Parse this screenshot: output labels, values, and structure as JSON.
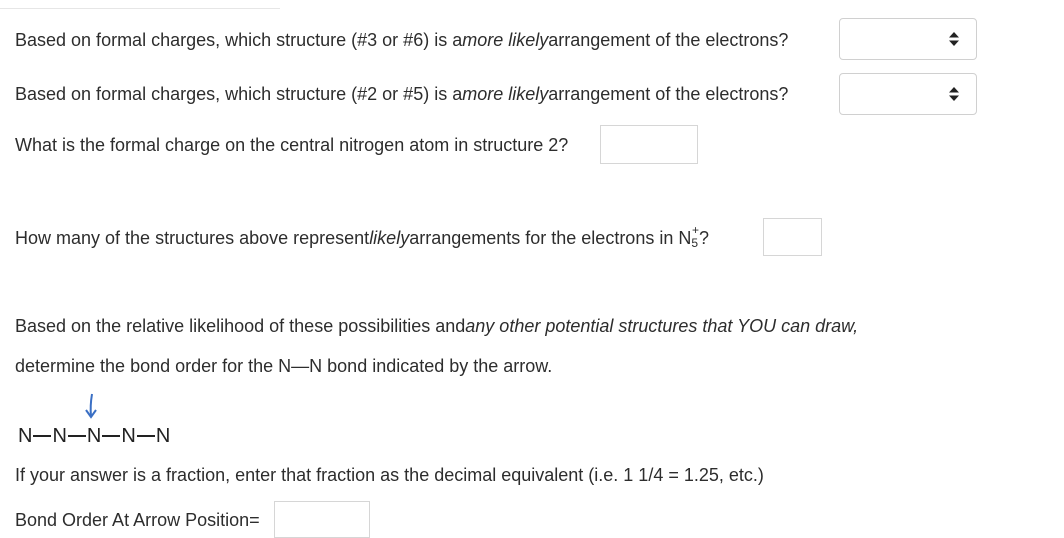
{
  "q1": {
    "pre": "Based on formal charges, which structure (#3 or #6) is a ",
    "em": "more likely",
    "post": " arrangement of the electrons?"
  },
  "q2": {
    "pre": "Based on formal charges, which structure (#2 or #5) is a ",
    "em": "more likely",
    "post": " arrangement of the electrons?"
  },
  "q3": {
    "text": "What is the formal charge on the central nitrogen atom in structure 2?"
  },
  "q4": {
    "pre": "How many of the structures above represent ",
    "em": "likely",
    "post": " arrangements for the electrons in N",
    "sub": "5",
    "sup": "+",
    "end": "?"
  },
  "q5": {
    "pre": "Based on the relative likelihood of these possibilities and ",
    "em": "any other potential structures that YOU can draw,",
    "line2": "determine the bond order for the N—N bond indicated by the arrow."
  },
  "chain": {
    "atoms": [
      "N",
      "N",
      "N",
      "N",
      "N"
    ]
  },
  "hint": "If your answer is a fraction, enter that fraction as the decimal equivalent (i.e. 1 1/4 = 1.25, etc.)",
  "bond_order_label": "Bond Order At Arrow Position=",
  "colors": {
    "arrow": "#3a6fc4",
    "text": "#2d2d2d",
    "border": "#d0d0d0"
  }
}
